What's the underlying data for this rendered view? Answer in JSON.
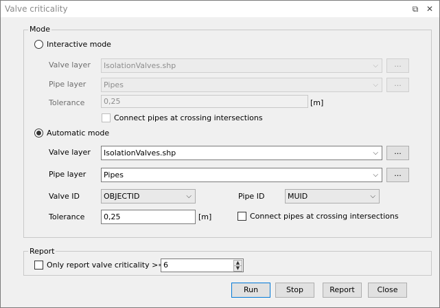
{
  "window": {
    "title": "Valve criticality",
    "restore_icon": "restore-icon",
    "close_icon": "close-icon"
  },
  "mode": {
    "group_label": "Mode",
    "interactive": {
      "label": "Interactive mode",
      "selected": false,
      "valve_layer_label": "Valve layer",
      "valve_layer_value": "IsolationValves.shp",
      "pipe_layer_label": "Pipe layer",
      "pipe_layer_value": "Pipes",
      "browse_label": "...",
      "tolerance_label": "Tolerance",
      "tolerance_value": "0,25",
      "tolerance_unit": "[m]",
      "connect_label": "Connect pipes at crossing intersections"
    },
    "automatic": {
      "label": "Automatic mode",
      "selected": true,
      "valve_layer_label": "Valve layer",
      "valve_layer_value": "IsolationValves.shp",
      "pipe_layer_label": "Pipe layer",
      "pipe_layer_value": "Pipes",
      "browse_label": "...",
      "valve_id_label": "Valve ID",
      "valve_id_value": "OBJECTID",
      "pipe_id_label": "Pipe ID",
      "pipe_id_value": "MUID",
      "tolerance_label": "Tolerance",
      "tolerance_value": "0,25",
      "tolerance_unit": "[m]",
      "connect_label": "Connect pipes at crossing intersections"
    }
  },
  "report": {
    "group_label": "Report",
    "only_report_label": "Only report valve criticality >=",
    "threshold_value": "6"
  },
  "buttons": {
    "run": "Run",
    "stop": "Stop",
    "report": "Report",
    "close": "Close"
  }
}
